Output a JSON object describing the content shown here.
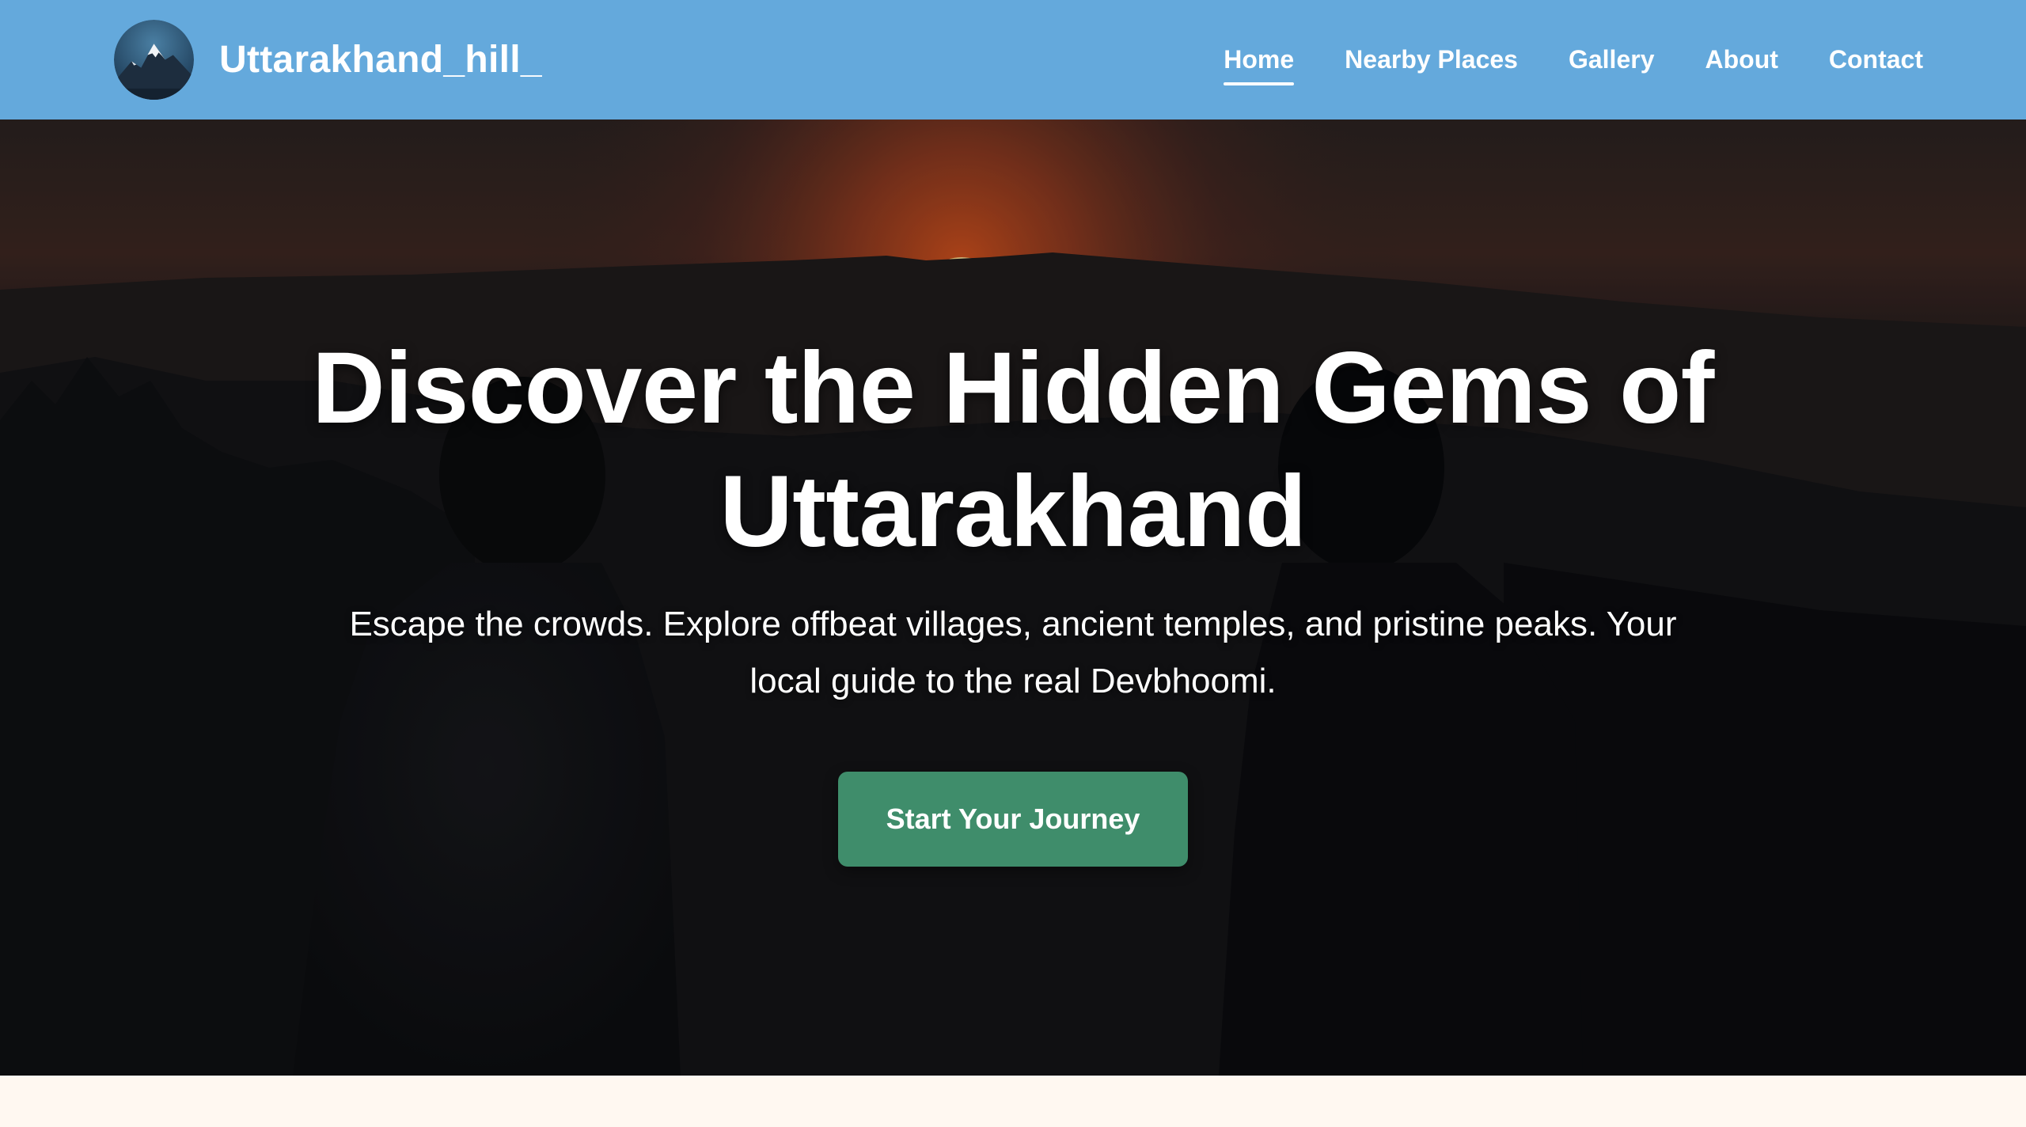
{
  "brand": {
    "name": "Uttarakhand_hill_",
    "logo_icon": "mountain-logo-icon"
  },
  "nav": {
    "items": [
      {
        "label": "Home",
        "active": true
      },
      {
        "label": "Nearby Places",
        "active": false
      },
      {
        "label": "Gallery",
        "active": false
      },
      {
        "label": "About",
        "active": false
      },
      {
        "label": "Contact",
        "active": false
      }
    ]
  },
  "hero": {
    "title": "Discover the Hidden Gems of Uttarakhand",
    "subtitle": "Escape the crowds. Explore offbeat villages, ancient temples, and pristine peaks. Your local guide to the real Devbhoomi.",
    "cta_label": "Start Your Journey",
    "background_image": "sunset-mountains-silhouettes-image"
  },
  "colors": {
    "navbar": "#64a9dc",
    "cta": "#3f8d6b",
    "page_background": "#fff8f1",
    "text": "#ffffff"
  }
}
